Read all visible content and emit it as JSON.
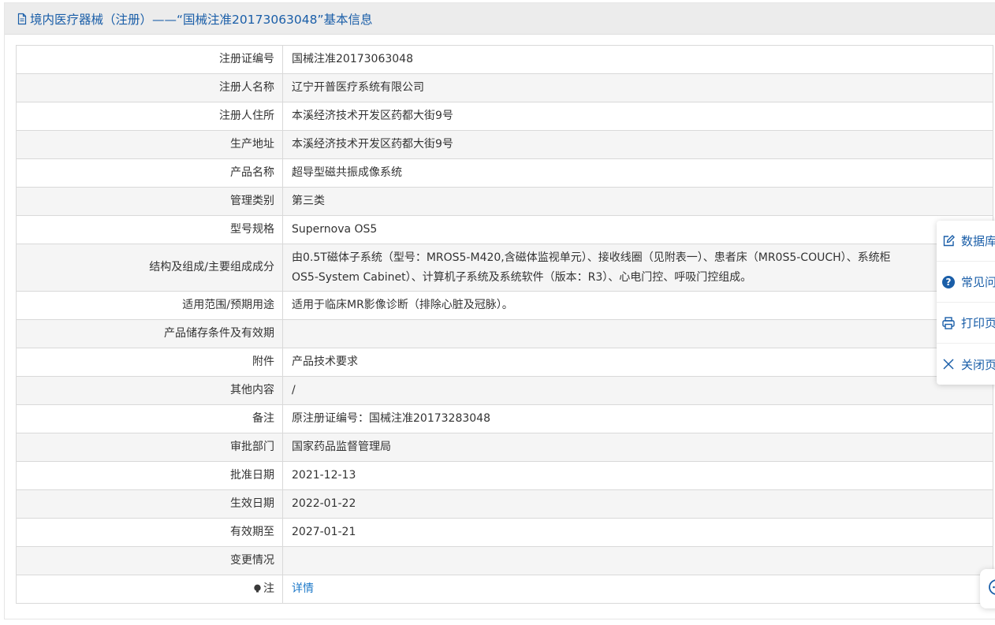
{
  "header": {
    "title": "境内医疗器械（注册）——“国械注准20173063048”基本信息",
    "icon": "document-icon",
    "title_color": "#1a5ea8"
  },
  "rows": [
    {
      "label": "注册证编号",
      "value": "国械注准20173063048"
    },
    {
      "label": "注册人名称",
      "value": "辽宁开普医疗系统有限公司"
    },
    {
      "label": "注册人住所",
      "value": "本溪经济技术开发区药都大街9号"
    },
    {
      "label": "生产地址",
      "value": "本溪经济技术开发区药都大街9号"
    },
    {
      "label": "产品名称",
      "value": "超导型磁共振成像系统"
    },
    {
      "label": "管理类别",
      "value": "第三类"
    },
    {
      "label": "型号规格",
      "value": "Supernova OS5"
    },
    {
      "label": "结构及组成/主要组成成分",
      "value_line1": "由0.5T磁体子系统（型号：MROS5-M420,含磁体监视单元）、接收线圈（见附表一）、患者床（MR0S5-COUCH）、系统柜",
      "value_line2": "OS5-System Cabinet）、计算机子系统及系统软件（版本：R3）、心电门控、呼吸门控组成。"
    },
    {
      "label": "适用范围/预期用途",
      "value": "适用于临床MR影像诊断（排除心脏及冠脉）。"
    },
    {
      "label": "产品储存条件及有效期",
      "value": ""
    },
    {
      "label": "附件",
      "value": "产品技术要求"
    },
    {
      "label": "其他内容",
      "value": "/"
    },
    {
      "label": "备注",
      "value": "原注册证编号：国械注准20173283048"
    },
    {
      "label": "审批部门",
      "value": "国家药品监督管理局"
    },
    {
      "label": "批准日期",
      "value": "2021-12-13"
    },
    {
      "label": "生效日期",
      "value": "2022-01-22"
    },
    {
      "label": "有效期至",
      "value": "2027-01-21"
    },
    {
      "label": "变更情况",
      "value": ""
    },
    {
      "label": "注",
      "value": "详情",
      "icon": "tip-bulb-icon"
    }
  ],
  "float_panel": {
    "items": [
      {
        "label": "数据库",
        "icon": "edit-icon"
      },
      {
        "label": "常见问",
        "icon": "help-icon"
      },
      {
        "label": "打印页",
        "icon": "print-icon"
      },
      {
        "label": "关闭页",
        "icon": "close-icon"
      }
    ]
  },
  "chat": {
    "icon": "chat-icon"
  },
  "colors": {
    "link": "#1e79c9",
    "accent": "#1a5ea8",
    "stripe": "#f5f5f5",
    "border": "#d9d9d9"
  }
}
